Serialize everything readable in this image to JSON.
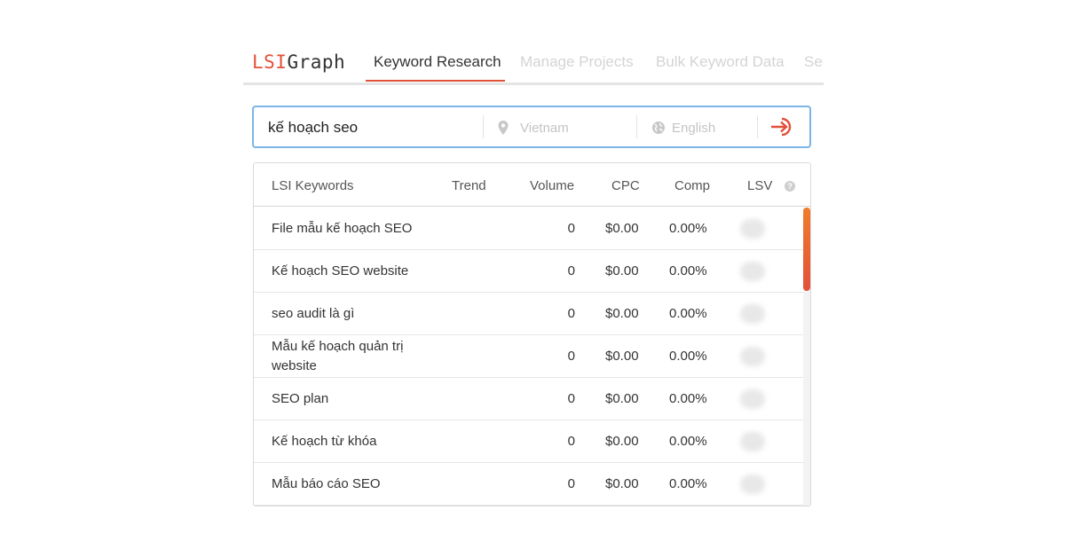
{
  "brand": {
    "lsi": "LSI",
    "graph": "Graph"
  },
  "nav": {
    "tabs": [
      {
        "label": "Keyword Research",
        "active": true
      },
      {
        "label": "Manage Projects",
        "active": false
      },
      {
        "label": "Bulk Keyword Data",
        "active": false
      },
      {
        "label": "Ser",
        "active": false
      }
    ]
  },
  "search": {
    "query": "kế hoạch seo",
    "location_placeholder": "Vietnam",
    "language_placeholder": "English",
    "go_icon": "arrow-enter-circle-icon"
  },
  "table": {
    "headers": {
      "keyword": "LSI Keywords",
      "trend": "Trend",
      "volume": "Volume",
      "cpc": "CPC",
      "comp": "Comp",
      "lsv": "LSV",
      "help": "?"
    },
    "rows": [
      {
        "keyword": "File mẫu kế hoạch SEO",
        "volume": "0",
        "cpc": "$0.00",
        "comp": "0.00%"
      },
      {
        "keyword": "Kế hoạch SEO website",
        "volume": "0",
        "cpc": "$0.00",
        "comp": "0.00%"
      },
      {
        "keyword": "seo audit là gì",
        "volume": "0",
        "cpc": "$0.00",
        "comp": "0.00%"
      },
      {
        "keyword": "Mẫu kế hoạch quản trị website",
        "volume": "0",
        "cpc": "$0.00",
        "comp": "0.00%"
      },
      {
        "keyword": "SEO plan",
        "volume": "0",
        "cpc": "$0.00",
        "comp": "0.00%"
      },
      {
        "keyword": "Kế hoạch từ khóa",
        "volume": "0",
        "cpc": "$0.00",
        "comp": "0.00%"
      },
      {
        "keyword": "Mẫu báo cáo SEO",
        "volume": "0",
        "cpc": "$0.00",
        "comp": "0.00%"
      }
    ]
  },
  "colors": {
    "accent": "#e2513a",
    "search_border": "#7db4e6",
    "scroll_thumb": "#ef7c2a"
  }
}
